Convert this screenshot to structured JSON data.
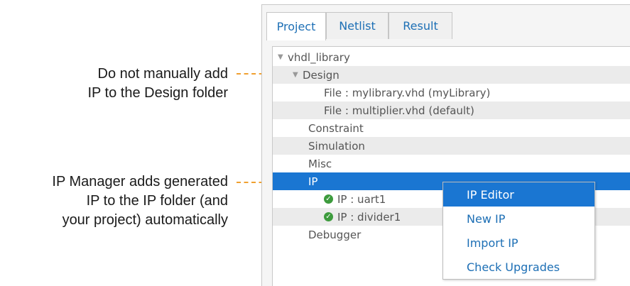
{
  "callouts": {
    "design": [
      "Do not manually add",
      "IP to the Design folder"
    ],
    "ip": [
      "IP Manager adds generated",
      "IP to the IP folder (and",
      "your project) automatically"
    ]
  },
  "tabs": [
    "Project",
    "Netlist",
    "Result"
  ],
  "tree": {
    "root": "vhdl_library",
    "design": "Design",
    "file1": "File : mylibrary.vhd (myLibrary)",
    "file2": "File : multiplier.vhd (default)",
    "constraint": "Constraint",
    "simulation": "Simulation",
    "misc": "Misc",
    "ip": "IP",
    "ip1": "IP : uart1",
    "ip2": "IP : divider1",
    "debugger": "Debugger"
  },
  "context_menu": [
    "IP Editor",
    "New IP",
    "Import IP",
    "Check Upgrades"
  ],
  "colors": {
    "accent": "#1a76d2",
    "link": "#1d6fb5",
    "leader": "#f0a030",
    "check": "#3d9b3d"
  }
}
